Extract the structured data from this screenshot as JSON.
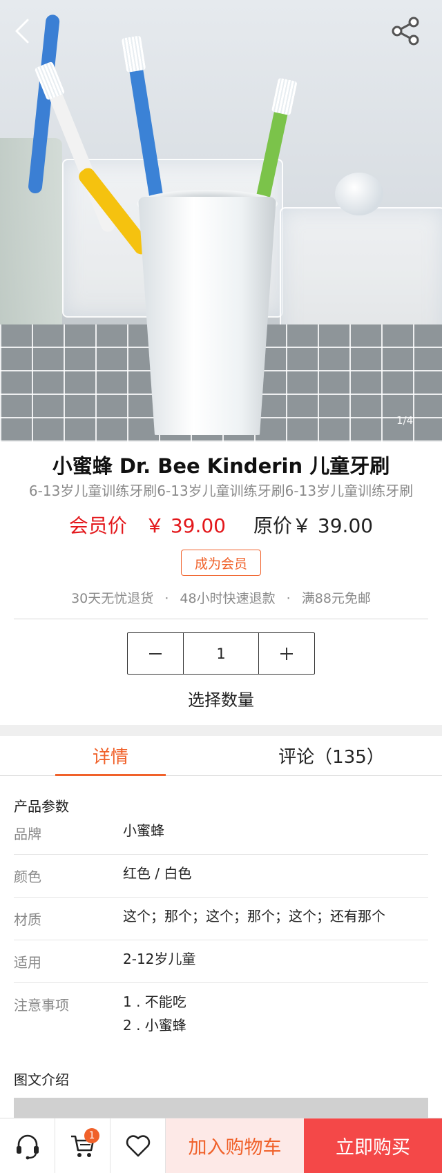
{
  "hero": {
    "pager": "1/4"
  },
  "product": {
    "title": "小蜜蜂 Dr. Bee Kinderin 儿童牙刷",
    "subtitle": "6-13岁儿童训练牙刷6-13岁儿童训练牙刷6-13岁儿童训练牙刷",
    "member_label": "会员价",
    "member_price": "￥ 39.00",
    "original_label": "原价",
    "original_price": "￥ 39.00",
    "become_member": "成为会员",
    "services": [
      "30天无忧退货",
      "48小时快速退款",
      "满88元免邮"
    ],
    "service_separator": "·"
  },
  "quantity": {
    "value": "1",
    "label": "选择数量"
  },
  "tabs": [
    {
      "label": "详情"
    },
    {
      "label": "评论（135）"
    }
  ],
  "params": {
    "title": "产品参数",
    "rows": [
      {
        "key": "品牌",
        "value": "小蜜蜂"
      },
      {
        "key": "颜色",
        "value": "红色 / 白色"
      },
      {
        "key": "材质",
        "value": "这个；那个；这个；那个；这个；还有那个"
      },
      {
        "key": "适用",
        "value": "2-12岁儿童"
      },
      {
        "key": "注意事项",
        "values": [
          "1 . 不能吃",
          "2 . 小蜜蜂"
        ]
      }
    ]
  },
  "intro": {
    "title": "图文介绍"
  },
  "bottom_bar": {
    "cart_count": "1",
    "add_to_cart": "加入购物车",
    "buy_now": "立即购买",
    "icons": [
      "customer-service-icon",
      "cart-icon",
      "heart-icon"
    ]
  },
  "colors": {
    "accent": "#f0612a",
    "price_red": "#e3171b",
    "buy_now_bg": "#f44848",
    "add_cart_bg": "#fde9e7"
  }
}
